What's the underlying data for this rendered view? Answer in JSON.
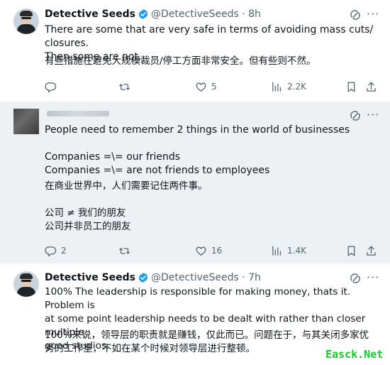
{
  "tweets": [
    {
      "name": "Detective Seeds",
      "handle": "@DetectiveSeeds · 8h",
      "text_en": "There are some that are very safe in terms of avoiding mass cuts/ closures.\nThen some are not.",
      "text_cn": "有些措施在避免大规模裁员/停工方面非常安全。但有些则不然。",
      "replies": "",
      "reposts": "",
      "likes": "5",
      "views": "2.2K"
    },
    {
      "name": "",
      "handle": "",
      "text_en": "People need to remember 2 things in the world of businesses\n\nCompanies =\\= our friends\nCompanies =\\= are not friends to employees",
      "text_cn": "在商业世界中，人们需要记住两件事。\n\n公司 ≠ 我们的朋友\n公司并非员工的朋友",
      "replies": "2",
      "reposts": "",
      "likes": "16",
      "views": "1.4K"
    },
    {
      "name": "Detective Seeds",
      "handle": "@DetectiveSeeds · 7h",
      "text_en": "100% The leadership is responsible for making money, thats it. Problem is\nat some point leadership needs to be dealt with rather than closer multiple\ngood studios.",
      "text_cn": "100%来说，领导层的职责就是赚钱，仅此而已。问题在于，与其关闭多家优\n秀的工作室，不如在某个时候对领导层进行整顿。"
    }
  ],
  "watermark": "Easck.Net",
  "colors": {
    "verified": "#1d9bf0",
    "muted": "#536471",
    "text": "#0f1419",
    "highlight_bg": "#eef1f4",
    "watermark": "#18c92c"
  },
  "icons": [
    "reply-icon",
    "repost-icon",
    "like-icon",
    "views-icon",
    "bookmark-icon",
    "share-icon",
    "grok-icon",
    "more-icon",
    "verified-badge-icon"
  ]
}
